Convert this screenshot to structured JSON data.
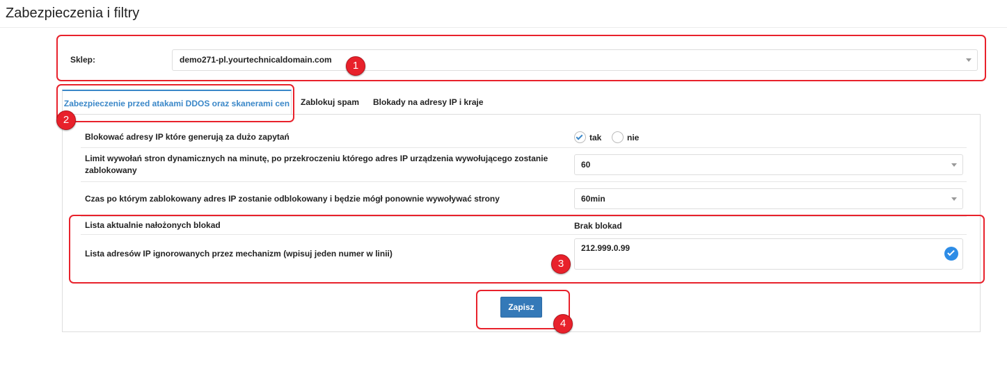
{
  "page": {
    "title": "Zabezpieczenia i filtry"
  },
  "shop": {
    "label": "Sklep:",
    "value": "demo271-pl.yourtechnicaldomain.com"
  },
  "tabs": [
    {
      "label": "Zabezpieczenie przed atakami DDOS oraz skanerami cen",
      "active": true
    },
    {
      "label": "Zablokuj spam",
      "active": false
    },
    {
      "label": "Blokady na adresy IP i kraje",
      "active": false
    }
  ],
  "settings": {
    "block_ips": {
      "label": "Blokować adresy IP które generują za dużo zapytań",
      "options": {
        "yes": "tak",
        "no": "nie"
      },
      "selected": "tak"
    },
    "limit": {
      "label_line1": "Limit wywołań stron dynamicznych na minutę, po przekroczeniu którego adres IP urządzenia wywołującego zostanie",
      "label_line2": "zablokowany",
      "value": "60"
    },
    "unblock_time": {
      "label": "Czas po którym zablokowany adres IP zostanie odblokowany i będzie mógł ponownie wywoływać strony",
      "value": "60min"
    },
    "current_blocks": {
      "label": "Lista aktualnie nałożonych blokad",
      "value": "Brak blokad"
    },
    "ignored_ips": {
      "label": "Lista adresów IP ignorowanych przez mechanizm (wpisuj jeden numer w linii)",
      "value": "212.999.0.99"
    }
  },
  "actions": {
    "save_label": "Zapisz"
  },
  "annotations": {
    "m1": "1",
    "m2": "2",
    "m3": "3",
    "m4": "4"
  },
  "colors": {
    "accent": "#3a87c8",
    "button": "#3479b8",
    "annotation": "#e8212b"
  }
}
